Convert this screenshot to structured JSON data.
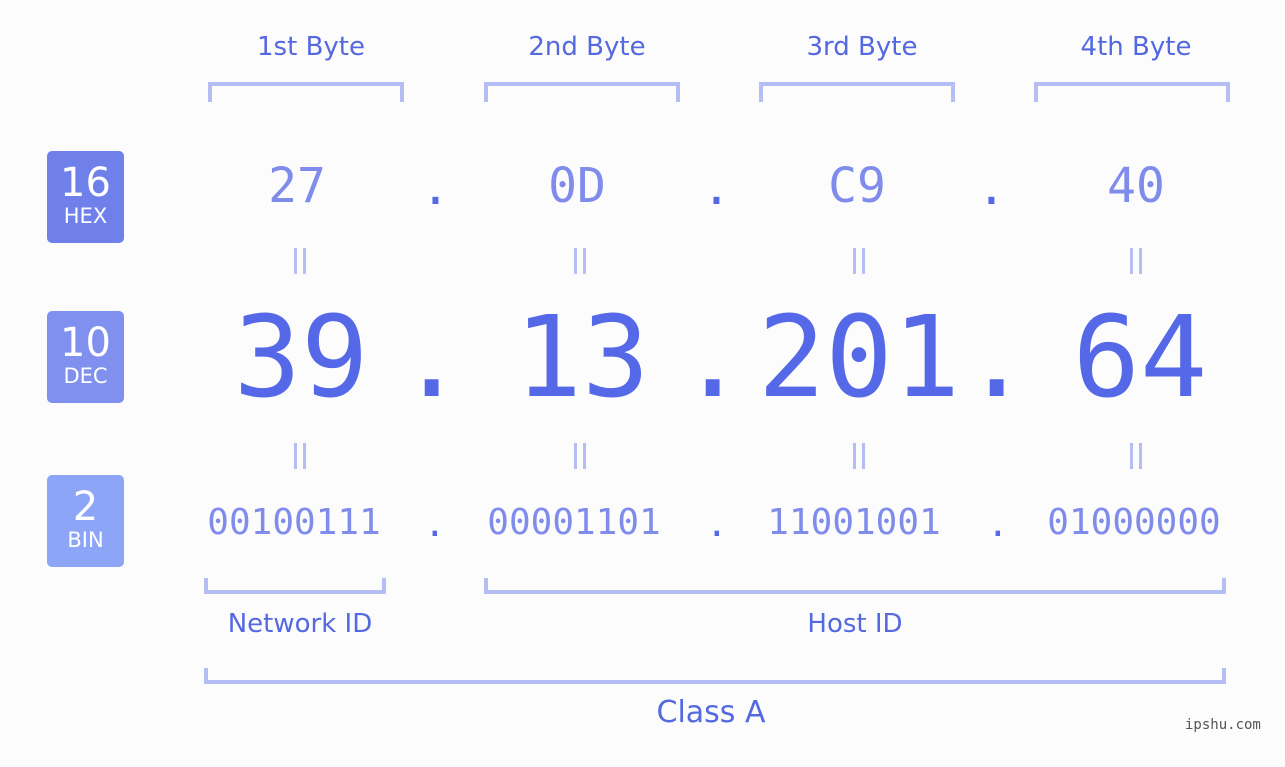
{
  "rows": {
    "hex": {
      "base": "16",
      "label": "HEX",
      "color": "#6f80ea"
    },
    "dec": {
      "base": "10",
      "label": "DEC",
      "color": "#8090ef"
    },
    "bin": {
      "base": "2",
      "label": "BIN",
      "color": "#8da5f7"
    }
  },
  "bytes": [
    {
      "label": "1st Byte",
      "hex": "27",
      "dec": "39",
      "bin": "00100111"
    },
    {
      "label": "2nd Byte",
      "hex": "0D",
      "dec": "13",
      "bin": "00001101"
    },
    {
      "label": "3rd Byte",
      "hex": "C9",
      "dec": "201",
      "bin": "11001001"
    },
    {
      "label": "4th Byte",
      "hex": "40",
      "dec": "64",
      "bin": "01000000"
    }
  ],
  "separator": ".",
  "equals": "=",
  "network_id_label": "Network ID",
  "host_id_label": "Host ID",
  "class_label": "Class A",
  "watermark": "ipshu.com"
}
